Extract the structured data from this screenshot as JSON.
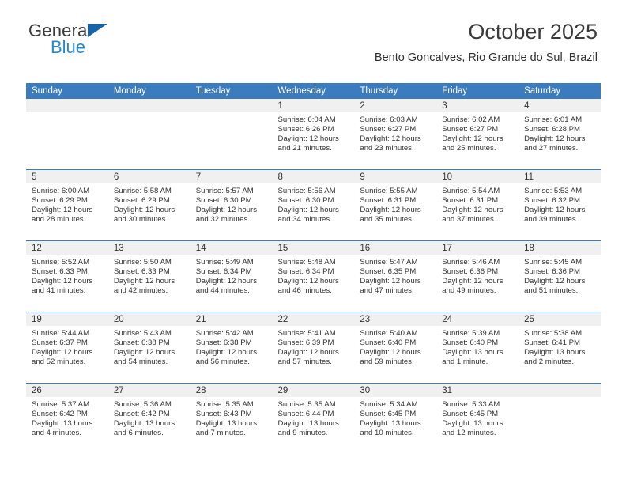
{
  "brand": {
    "name_part1": "General",
    "name_part2": "Blue",
    "triangle_color": "#1565a8",
    "blue_color": "#2389d6"
  },
  "header": {
    "month_title": "October 2025",
    "location": "Bento Goncalves, Rio Grande do Sul, Brazil"
  },
  "theme": {
    "header_bg": "#3a7cbe",
    "daynum_bg": "#f0f0f0",
    "text_color": "#333333"
  },
  "calendar": {
    "weekday_headers": [
      "Sunday",
      "Monday",
      "Tuesday",
      "Wednesday",
      "Thursday",
      "Friday",
      "Saturday"
    ],
    "weeks": [
      [
        {
          "day": "",
          "lines": []
        },
        {
          "day": "",
          "lines": []
        },
        {
          "day": "",
          "lines": []
        },
        {
          "day": "1",
          "lines": [
            "Sunrise: 6:04 AM",
            "Sunset: 6:26 PM",
            "Daylight: 12 hours",
            "and 21 minutes."
          ]
        },
        {
          "day": "2",
          "lines": [
            "Sunrise: 6:03 AM",
            "Sunset: 6:27 PM",
            "Daylight: 12 hours",
            "and 23 minutes."
          ]
        },
        {
          "day": "3",
          "lines": [
            "Sunrise: 6:02 AM",
            "Sunset: 6:27 PM",
            "Daylight: 12 hours",
            "and 25 minutes."
          ]
        },
        {
          "day": "4",
          "lines": [
            "Sunrise: 6:01 AM",
            "Sunset: 6:28 PM",
            "Daylight: 12 hours",
            "and 27 minutes."
          ]
        }
      ],
      [
        {
          "day": "5",
          "lines": [
            "Sunrise: 6:00 AM",
            "Sunset: 6:29 PM",
            "Daylight: 12 hours",
            "and 28 minutes."
          ]
        },
        {
          "day": "6",
          "lines": [
            "Sunrise: 5:58 AM",
            "Sunset: 6:29 PM",
            "Daylight: 12 hours",
            "and 30 minutes."
          ]
        },
        {
          "day": "7",
          "lines": [
            "Sunrise: 5:57 AM",
            "Sunset: 6:30 PM",
            "Daylight: 12 hours",
            "and 32 minutes."
          ]
        },
        {
          "day": "8",
          "lines": [
            "Sunrise: 5:56 AM",
            "Sunset: 6:30 PM",
            "Daylight: 12 hours",
            "and 34 minutes."
          ]
        },
        {
          "day": "9",
          "lines": [
            "Sunrise: 5:55 AM",
            "Sunset: 6:31 PM",
            "Daylight: 12 hours",
            "and 35 minutes."
          ]
        },
        {
          "day": "10",
          "lines": [
            "Sunrise: 5:54 AM",
            "Sunset: 6:31 PM",
            "Daylight: 12 hours",
            "and 37 minutes."
          ]
        },
        {
          "day": "11",
          "lines": [
            "Sunrise: 5:53 AM",
            "Sunset: 6:32 PM",
            "Daylight: 12 hours",
            "and 39 minutes."
          ]
        }
      ],
      [
        {
          "day": "12",
          "lines": [
            "Sunrise: 5:52 AM",
            "Sunset: 6:33 PM",
            "Daylight: 12 hours",
            "and 41 minutes."
          ]
        },
        {
          "day": "13",
          "lines": [
            "Sunrise: 5:50 AM",
            "Sunset: 6:33 PM",
            "Daylight: 12 hours",
            "and 42 minutes."
          ]
        },
        {
          "day": "14",
          "lines": [
            "Sunrise: 5:49 AM",
            "Sunset: 6:34 PM",
            "Daylight: 12 hours",
            "and 44 minutes."
          ]
        },
        {
          "day": "15",
          "lines": [
            "Sunrise: 5:48 AM",
            "Sunset: 6:34 PM",
            "Daylight: 12 hours",
            "and 46 minutes."
          ]
        },
        {
          "day": "16",
          "lines": [
            "Sunrise: 5:47 AM",
            "Sunset: 6:35 PM",
            "Daylight: 12 hours",
            "and 47 minutes."
          ]
        },
        {
          "day": "17",
          "lines": [
            "Sunrise: 5:46 AM",
            "Sunset: 6:36 PM",
            "Daylight: 12 hours",
            "and 49 minutes."
          ]
        },
        {
          "day": "18",
          "lines": [
            "Sunrise: 5:45 AM",
            "Sunset: 6:36 PM",
            "Daylight: 12 hours",
            "and 51 minutes."
          ]
        }
      ],
      [
        {
          "day": "19",
          "lines": [
            "Sunrise: 5:44 AM",
            "Sunset: 6:37 PM",
            "Daylight: 12 hours",
            "and 52 minutes."
          ]
        },
        {
          "day": "20",
          "lines": [
            "Sunrise: 5:43 AM",
            "Sunset: 6:38 PM",
            "Daylight: 12 hours",
            "and 54 minutes."
          ]
        },
        {
          "day": "21",
          "lines": [
            "Sunrise: 5:42 AM",
            "Sunset: 6:38 PM",
            "Daylight: 12 hours",
            "and 56 minutes."
          ]
        },
        {
          "day": "22",
          "lines": [
            "Sunrise: 5:41 AM",
            "Sunset: 6:39 PM",
            "Daylight: 12 hours",
            "and 57 minutes."
          ]
        },
        {
          "day": "23",
          "lines": [
            "Sunrise: 5:40 AM",
            "Sunset: 6:40 PM",
            "Daylight: 12 hours",
            "and 59 minutes."
          ]
        },
        {
          "day": "24",
          "lines": [
            "Sunrise: 5:39 AM",
            "Sunset: 6:40 PM",
            "Daylight: 13 hours",
            "and 1 minute."
          ]
        },
        {
          "day": "25",
          "lines": [
            "Sunrise: 5:38 AM",
            "Sunset: 6:41 PM",
            "Daylight: 13 hours",
            "and 2 minutes."
          ]
        }
      ],
      [
        {
          "day": "26",
          "lines": [
            "Sunrise: 5:37 AM",
            "Sunset: 6:42 PM",
            "Daylight: 13 hours",
            "and 4 minutes."
          ]
        },
        {
          "day": "27",
          "lines": [
            "Sunrise: 5:36 AM",
            "Sunset: 6:42 PM",
            "Daylight: 13 hours",
            "and 6 minutes."
          ]
        },
        {
          "day": "28",
          "lines": [
            "Sunrise: 5:35 AM",
            "Sunset: 6:43 PM",
            "Daylight: 13 hours",
            "and 7 minutes."
          ]
        },
        {
          "day": "29",
          "lines": [
            "Sunrise: 5:35 AM",
            "Sunset: 6:44 PM",
            "Daylight: 13 hours",
            "and 9 minutes."
          ]
        },
        {
          "day": "30",
          "lines": [
            "Sunrise: 5:34 AM",
            "Sunset: 6:45 PM",
            "Daylight: 13 hours",
            "and 10 minutes."
          ]
        },
        {
          "day": "31",
          "lines": [
            "Sunrise: 5:33 AM",
            "Sunset: 6:45 PM",
            "Daylight: 13 hours",
            "and 12 minutes."
          ]
        },
        {
          "day": "",
          "lines": []
        }
      ]
    ]
  }
}
